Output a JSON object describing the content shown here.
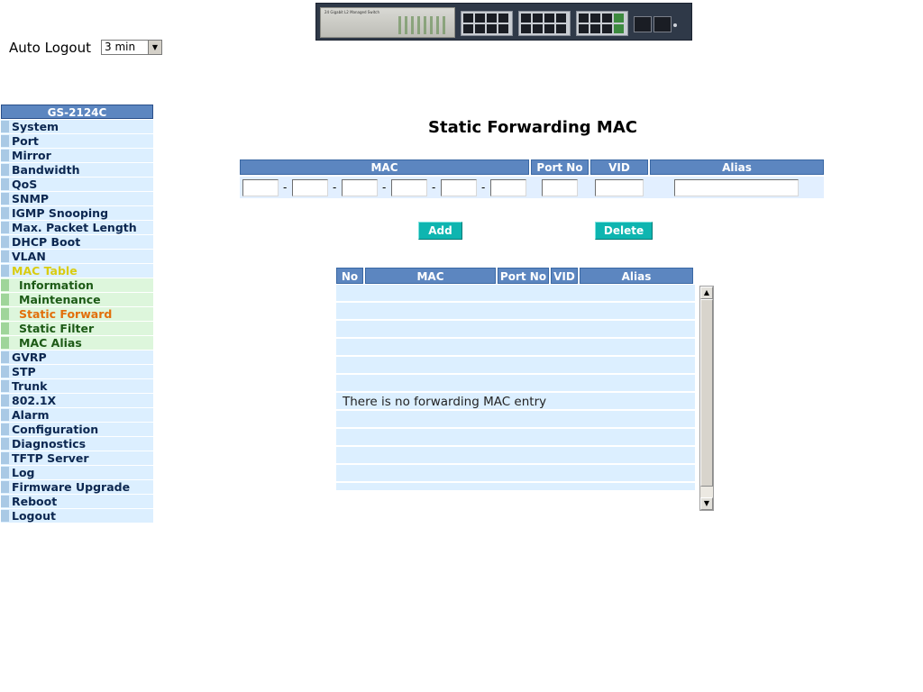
{
  "header": {
    "device_label": "24 Gigabit L2 Managed Switch"
  },
  "auto_logout": {
    "label": "Auto Logout",
    "value": "3 min"
  },
  "sidebar": {
    "title": "GS-2124C",
    "items": [
      {
        "label": "System"
      },
      {
        "label": "Port"
      },
      {
        "label": "Mirror"
      },
      {
        "label": "Bandwidth"
      },
      {
        "label": "QoS"
      },
      {
        "label": "SNMP"
      },
      {
        "label": "IGMP Snooping"
      },
      {
        "label": "Max. Packet Length"
      },
      {
        "label": "DHCP Boot"
      },
      {
        "label": "VLAN"
      },
      {
        "label": "MAC Table",
        "state": "open"
      },
      {
        "label": "Information",
        "sub": true
      },
      {
        "label": "Maintenance",
        "sub": true
      },
      {
        "label": "Static Forward",
        "sub": true,
        "state": "active"
      },
      {
        "label": "Static Filter",
        "sub": true
      },
      {
        "label": "MAC Alias",
        "sub": true
      },
      {
        "label": "GVRP"
      },
      {
        "label": "STP"
      },
      {
        "label": "Trunk"
      },
      {
        "label": "802.1X"
      },
      {
        "label": "Alarm"
      },
      {
        "label": "Configuration"
      },
      {
        "label": "Diagnostics"
      },
      {
        "label": "TFTP Server"
      },
      {
        "label": "Log"
      },
      {
        "label": "Firmware Upgrade"
      },
      {
        "label": "Reboot"
      },
      {
        "label": "Logout"
      }
    ]
  },
  "page": {
    "title": "Static Forwarding MAC"
  },
  "entry_table": {
    "headers": {
      "mac": "MAC",
      "port_no": "Port No",
      "vid": "VID",
      "alias": "Alias"
    },
    "separator": "-",
    "values": {
      "mac1": "",
      "mac2": "",
      "mac3": "",
      "mac4": "",
      "mac5": "",
      "mac6": "",
      "port_no": "",
      "vid": "",
      "alias": ""
    }
  },
  "buttons": {
    "add": "Add",
    "delete": "Delete"
  },
  "list_table": {
    "headers": {
      "no": "No",
      "mac": "MAC",
      "port_no": "Port No",
      "vid": "VID",
      "alias": "Alias"
    },
    "empty_message": "There is no forwarding MAC entry"
  },
  "icons": {
    "scroll_up": "arrow-up-icon",
    "scroll_down": "arrow-down-icon",
    "select_arrow": "chevron-down-icon"
  },
  "colors": {
    "header_blue": "#5c86c0",
    "button_teal": "#0eb5b0",
    "row_blue": "#dcefff",
    "sub_green": "#ddf6dc",
    "active_orange": "#e26f0a",
    "open_yellow": "#d9cc10"
  }
}
